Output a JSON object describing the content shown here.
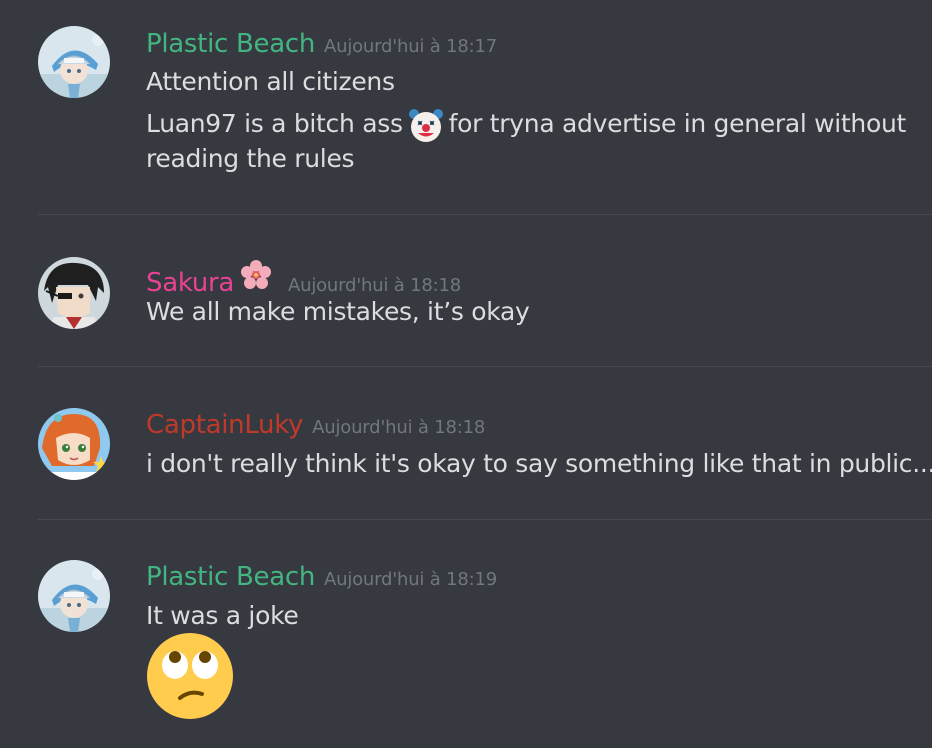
{
  "colors": {
    "background": "#36393f",
    "text": "#dcddde",
    "timestamp": "#72767d",
    "plastic_beach": "#43b581",
    "sakura": "#e84393",
    "captain_luky": "#c0392b"
  },
  "messages": [
    {
      "username": "Plastic Beach",
      "timestamp": "Aujourd'hui à 18:17",
      "line1": "Attention all citizens",
      "line2_before": "Luan97 is a bitch ass",
      "line2_emoji": "clown-face-emoji",
      "line2_after": "for tryna advertise in general without",
      "line3": "reading the rules"
    },
    {
      "username": "Sakura",
      "name_emoji": "cherry-blossom-emoji",
      "timestamp": "Aujourd'hui à 18:18",
      "line1": "We all make mistakes, it’s okay"
    },
    {
      "username": "CaptainLuky",
      "timestamp": "Aujourd'hui à 18:18",
      "line1": "i don't really think it's okay to say something like that in public..."
    },
    {
      "username": "Plastic Beach",
      "timestamp": "Aujourd'hui à 18:19",
      "line1": "It was a joke",
      "big_emoji": "face-with-rolling-eyes-emoji"
    }
  ]
}
